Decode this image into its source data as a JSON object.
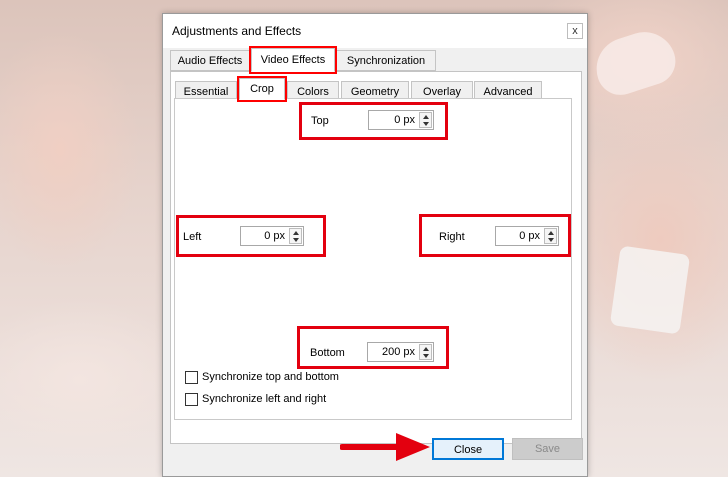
{
  "window": {
    "title": "Adjustments and Effects",
    "close_glyph": "x"
  },
  "main_tabs": [
    {
      "label": "Audio Effects"
    },
    {
      "label": "Video Effects",
      "active": true
    },
    {
      "label": "Synchronization"
    }
  ],
  "sub_tabs": [
    {
      "label": "Essential"
    },
    {
      "label": "Crop",
      "active": true
    },
    {
      "label": "Colors"
    },
    {
      "label": "Geometry"
    },
    {
      "label": "Overlay"
    },
    {
      "label": "Advanced"
    }
  ],
  "crop": {
    "top": {
      "label": "Top",
      "value": "0 px"
    },
    "left": {
      "label": "Left",
      "value": "0 px"
    },
    "right": {
      "label": "Right",
      "value": "0 px"
    },
    "bottom": {
      "label": "Bottom",
      "value": "200 px"
    },
    "sync_top_bottom": {
      "label": "Synchronize top and bottom",
      "checked": false
    },
    "sync_left_right": {
      "label": "Synchronize left and right",
      "checked": false
    }
  },
  "buttons": {
    "close": "Close",
    "save": "Save"
  },
  "colors": {
    "highlight": "#e3000f",
    "focus_border": "#0078d7"
  }
}
